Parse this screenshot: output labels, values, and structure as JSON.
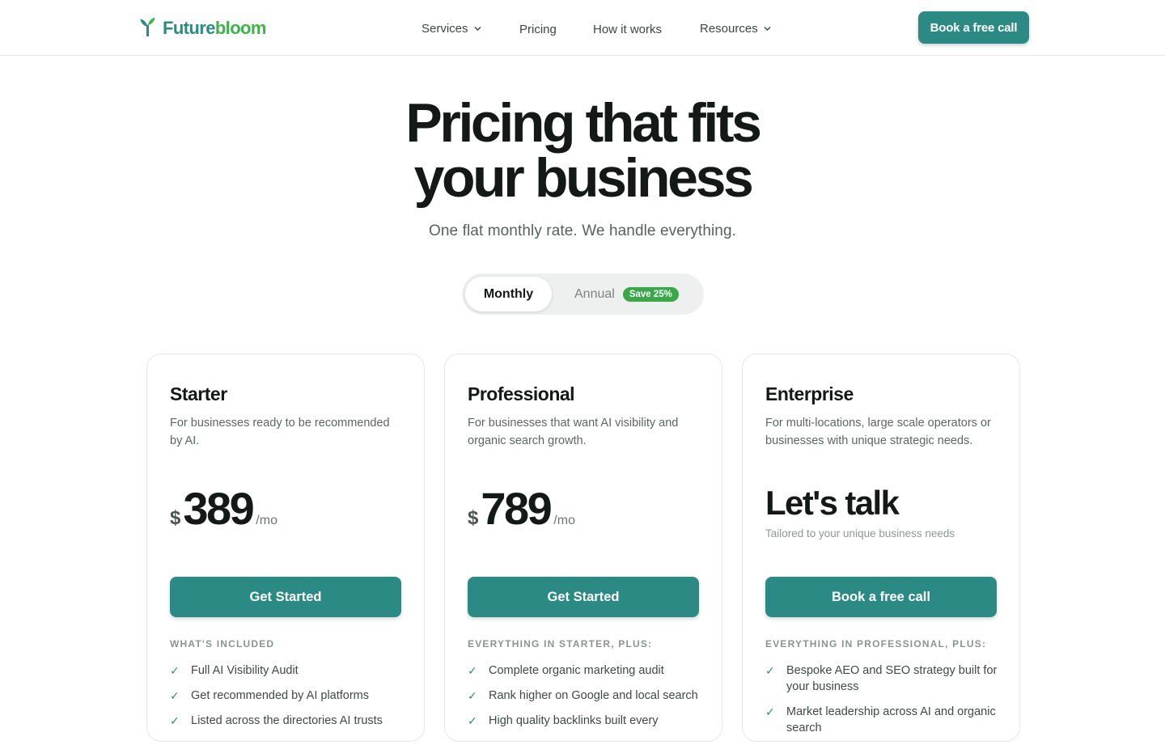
{
  "header": {
    "logo": {
      "part1": "Future",
      "part2": "bloom",
      "icon": "sprout-icon"
    },
    "nav": [
      {
        "label": "Services",
        "has_dropdown": true
      },
      {
        "label": "Pricing",
        "has_dropdown": false
      },
      {
        "label": "How it works",
        "has_dropdown": false
      },
      {
        "label": "Resources",
        "has_dropdown": true
      }
    ],
    "cta_label": "Book a free call"
  },
  "hero": {
    "title_line1": "Pricing that fits",
    "title_line2": "your business",
    "subtitle": "One flat monthly rate. We handle everything."
  },
  "billing_toggle": {
    "monthly_label": "Monthly",
    "annual_label": "Annual",
    "save_badge": "Save 25%",
    "selected": "Monthly"
  },
  "plans": [
    {
      "name": "Starter",
      "description": "For businesses ready to be recommended by AI.",
      "currency": "$",
      "price": "389",
      "period": "/mo",
      "cta": "Get Started",
      "included_heading": "WHAT'S INCLUDED",
      "features": [
        "Full AI Visibility Audit",
        "Get recommended by AI platforms",
        "Listed across the directories AI trusts"
      ]
    },
    {
      "name": "Professional",
      "description": "For businesses that want AI visibility and organic search growth.",
      "currency": "$",
      "price": "789",
      "period": "/mo",
      "cta": "Get Started",
      "included_heading": "EVERYTHING IN STARTER, PLUS:",
      "features": [
        "Complete organic marketing audit",
        "Rank higher on Google and local search",
        "High quality backlinks built every"
      ]
    },
    {
      "name": "Enterprise",
      "description": "For multi-locations, large scale operators or businesses with unique strategic needs.",
      "price_text": "Let's talk",
      "price_sub": "Tailored to your unique business needs",
      "cta": "Book a free call",
      "included_heading": "EVERYTHING IN PROFESSIONAL, PLUS:",
      "features": [
        "Bespoke AEO and SEO strategy built for your business",
        "Market leadership across AI and organic search"
      ]
    }
  ],
  "colors": {
    "brand_teal": "#2b8a83",
    "brand_green": "#3fb24a",
    "badge_green": "#3aa84a"
  }
}
